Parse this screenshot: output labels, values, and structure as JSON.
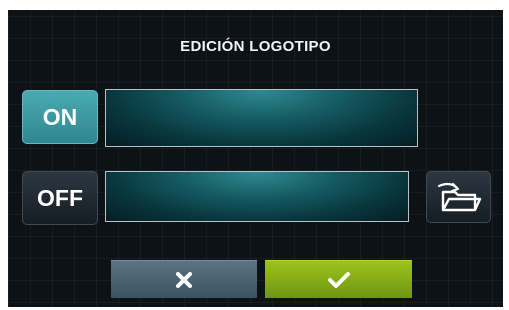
{
  "header": {
    "title": "EDICIÓN LOGOTIPO"
  },
  "rows": {
    "on": {
      "label": "ON"
    },
    "off": {
      "label": "OFF"
    }
  },
  "icons": {
    "folder": "folder-open-icon",
    "cancel": "x-icon",
    "confirm": "checkmark-icon"
  },
  "colors": {
    "on_active": "#3a969d",
    "confirm": "#8ab318",
    "cancel": "#4d6472",
    "background": "#0d1217"
  }
}
